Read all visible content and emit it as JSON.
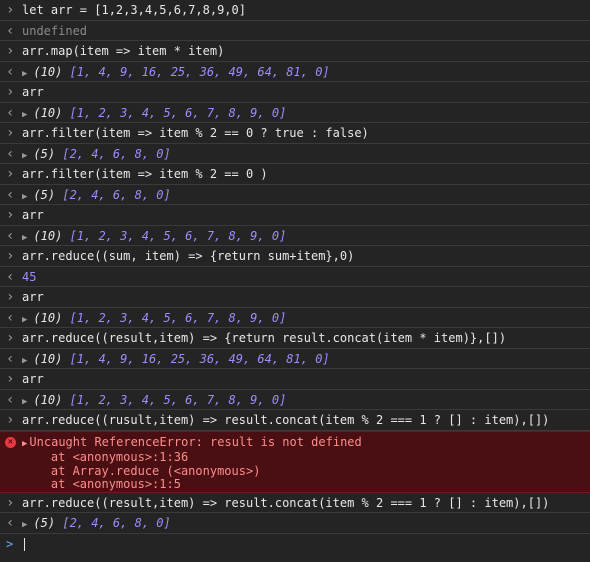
{
  "lines": [
    {
      "kind": "input",
      "text": "let arr = [1,2,3,4,5,6,7,8,9,0]"
    },
    {
      "kind": "output-plain",
      "text": "undefined"
    },
    {
      "kind": "input",
      "text": "arr.map(item => item * item)"
    },
    {
      "kind": "output-array",
      "count": "(10)",
      "values": "[1, 4, 9, 16, 25, 36, 49, 64, 81, 0]"
    },
    {
      "kind": "input",
      "text": "arr"
    },
    {
      "kind": "output-array",
      "count": "(10)",
      "values": "[1, 2, 3, 4, 5, 6, 7, 8, 9, 0]"
    },
    {
      "kind": "input",
      "text": "arr.filter(item => item % 2 == 0 ? true : false)"
    },
    {
      "kind": "output-array",
      "count": "(5)",
      "values": "[2, 4, 6, 8, 0]"
    },
    {
      "kind": "input",
      "text": "arr.filter(item => item % 2 == 0 )"
    },
    {
      "kind": "output-array",
      "count": "(5)",
      "values": "[2, 4, 6, 8, 0]"
    },
    {
      "kind": "input",
      "text": "arr"
    },
    {
      "kind": "output-array",
      "count": "(10)",
      "values": "[1, 2, 3, 4, 5, 6, 7, 8, 9, 0]"
    },
    {
      "kind": "input",
      "text": "arr.reduce((sum, item) => {return sum+item},0)"
    },
    {
      "kind": "output-number",
      "text": "45"
    },
    {
      "kind": "input",
      "text": "arr"
    },
    {
      "kind": "output-array",
      "count": "(10)",
      "values": "[1, 2, 3, 4, 5, 6, 7, 8, 9, 0]"
    },
    {
      "kind": "input",
      "text": "arr.reduce((result,item) => {return result.concat(item * item)},[])"
    },
    {
      "kind": "output-array",
      "count": "(10)",
      "values": "[1, 4, 9, 16, 25, 36, 49, 64, 81, 0]"
    },
    {
      "kind": "input",
      "text": "arr"
    },
    {
      "kind": "output-array",
      "count": "(10)",
      "values": "[1, 2, 3, 4, 5, 6, 7, 8, 9, 0]"
    },
    {
      "kind": "input",
      "text": "arr.reduce((rusult,item) => result.concat(item % 2 === 1 ? [] : item),[])"
    }
  ],
  "error": {
    "message": "Uncaught ReferenceError: result is not defined",
    "stack": [
      "    at <anonymous>:1:36",
      "    at Array.reduce (<anonymous>)",
      "    at <anonymous>:1:5"
    ]
  },
  "after_error": [
    {
      "kind": "input",
      "text": "arr.reduce((result,item) => result.concat(item % 2 === 1 ? [] : item),[])"
    },
    {
      "kind": "output-array",
      "count": "(5)",
      "values": "[2, 4, 6, 8, 0]"
    }
  ],
  "prompt": {
    "caret": ">"
  },
  "icons": {
    "input": "chevron-right-icon",
    "output": "chevron-left-icon",
    "expand": "triangle-right-icon",
    "error": "error-icon"
  },
  "colors": {
    "background": "#242424",
    "number": "#9d8cff",
    "error_bg": "#4a0f12",
    "error_text": "#ff8c8c"
  }
}
